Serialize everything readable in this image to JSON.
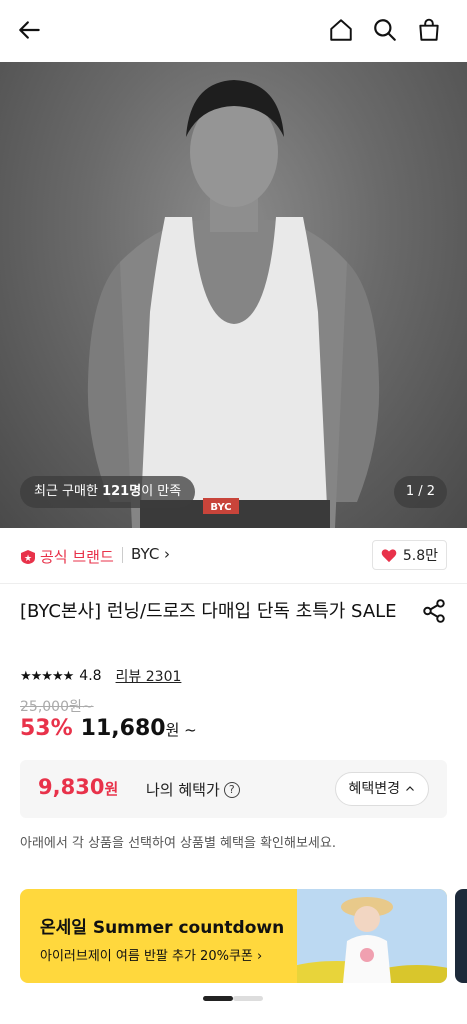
{
  "topbar": {
    "icons": [
      "back-arrow-icon",
      "home-icon",
      "search-icon",
      "shopping-bag-icon"
    ]
  },
  "hero": {
    "recent_prefix": "최근 구매한 ",
    "recent_count": "121명",
    "recent_suffix": "이 만족",
    "page_indicator": "1 / 2",
    "waistband_text": "BYC"
  },
  "brand": {
    "official_label": "공식 브랜드",
    "brand_name": "BYC ›",
    "likes": "5.8만"
  },
  "product": {
    "title": "[BYC본사] 런닝/드로즈 다매입 단독 초특가 SALE",
    "stars": "★★★★★",
    "rating": "4.8",
    "review": "리뷰 2301",
    "original_price": "25,000원~",
    "discount": "53%",
    "price": "11,680",
    "price_unit": "원 ~"
  },
  "benefit": {
    "value": "9,830",
    "unit": "원",
    "label": "나의 혜택가",
    "help": "?",
    "change_button": "혜택변경"
  },
  "notice": "아래에서 각 상품을 선택하여 상품별 혜택을 확인해보세요.",
  "banner": {
    "headline": "온세일 Summer countdown",
    "sub": "아이러브제이 여름 반팔 추가 20%쿠폰 ›"
  },
  "colors": {
    "accent": "#e8324a",
    "banner_bg": "#ffd83d"
  }
}
